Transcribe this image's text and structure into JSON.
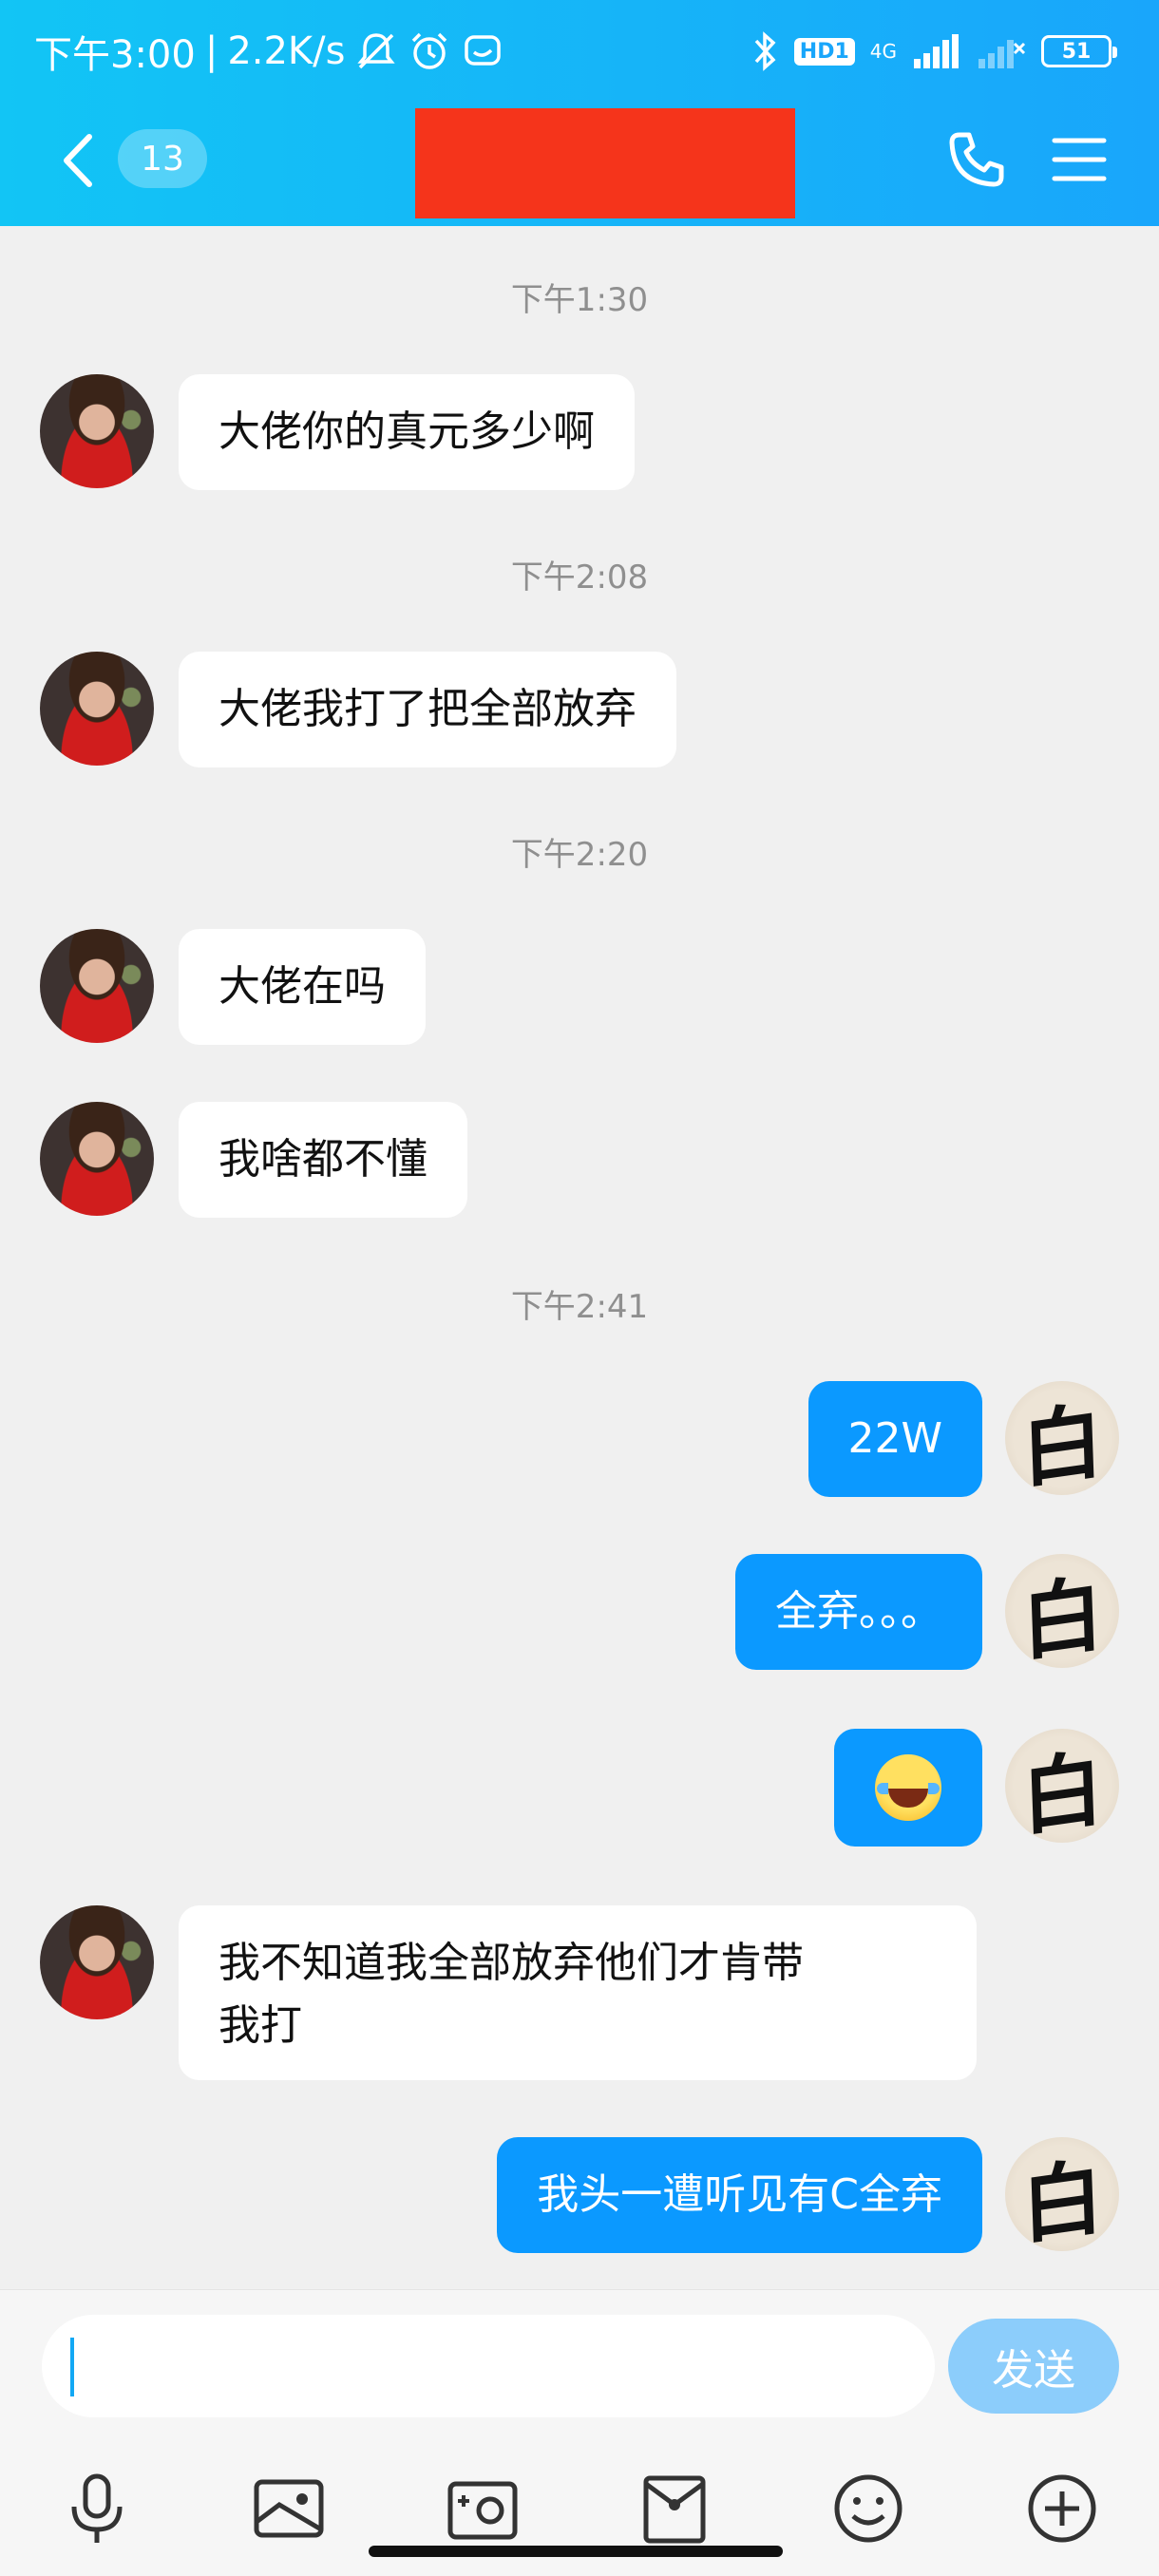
{
  "status_bar": {
    "time": "下午3:00",
    "net_speed": "2.2K/s",
    "hd_label": "HD1",
    "network_type": "4G",
    "battery": "51"
  },
  "nav": {
    "unread_count": "13"
  },
  "messages": [
    {
      "timestamp": "下午1:30"
    },
    {
      "side": "in",
      "text": "大佬你的真元多少啊"
    },
    {
      "timestamp": "下午2:08"
    },
    {
      "side": "in",
      "text": "大佬我打了把全部放弃"
    },
    {
      "timestamp": "下午2:20"
    },
    {
      "side": "in",
      "text": "大佬在吗"
    },
    {
      "side": "in",
      "text": "我啥都不懂"
    },
    {
      "timestamp": "下午2:41"
    },
    {
      "side": "out",
      "text": "22W"
    },
    {
      "side": "out",
      "text": "全弃。。。"
    },
    {
      "side": "out",
      "emoji": "tears-of-joy"
    },
    {
      "side": "in",
      "text_line1": "我不知道我全部放弃他们才肯带",
      "text_line2": "我打"
    },
    {
      "side": "out",
      "text": "我头一遭听见有C全弃"
    }
  ],
  "my_avatar_glyph": "白",
  "input": {
    "value": "",
    "send_label": "发送"
  },
  "icons": {
    "toolbar": [
      "microphone-icon",
      "gallery-icon",
      "camera-icon",
      "red-packet-icon",
      "emoji-icon",
      "plus-icon"
    ]
  },
  "colors": {
    "header": "#19a6fb",
    "outgoing_bubble": "#0b99ff",
    "incoming_bubble": "#ffffff",
    "send_button": "#8ccdfb",
    "redaction": "#f5341b"
  }
}
